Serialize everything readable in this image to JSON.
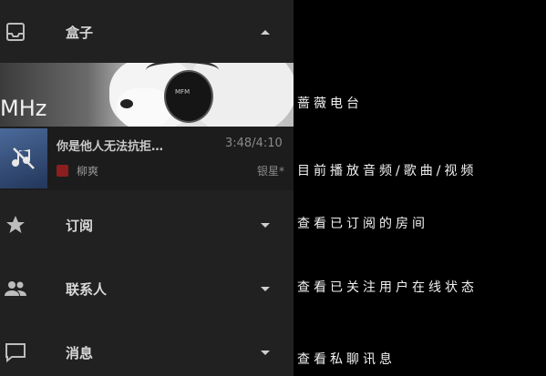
{
  "drawer": {
    "box": {
      "label": "盒子",
      "icon": "inbox-icon"
    },
    "radio_banner": {
      "frequency_text": "MHz",
      "headphone_text": "MFM"
    },
    "now_playing": {
      "title": "你是他人无法抗拒…",
      "time": "3:48/4:10",
      "artist": "柳爽",
      "tag": "银星*"
    },
    "subscribe": {
      "label": "订阅",
      "icon": "star-icon"
    },
    "contacts": {
      "label": "联系人",
      "icon": "people-icon"
    },
    "messages": {
      "label": "消息",
      "icon": "chat-icon"
    }
  },
  "annotations": {
    "radio": "蔷薇电台",
    "playing": "目前播放音频/歌曲/视频",
    "subscribe": "查看已订阅的房间",
    "contacts": "查看已关注用户在线状态",
    "messages": "查看私聊讯息"
  },
  "colors": {
    "drawer_bg": "#212121",
    "page_bg": "#000000",
    "accent_red": "#8b1f1f"
  }
}
